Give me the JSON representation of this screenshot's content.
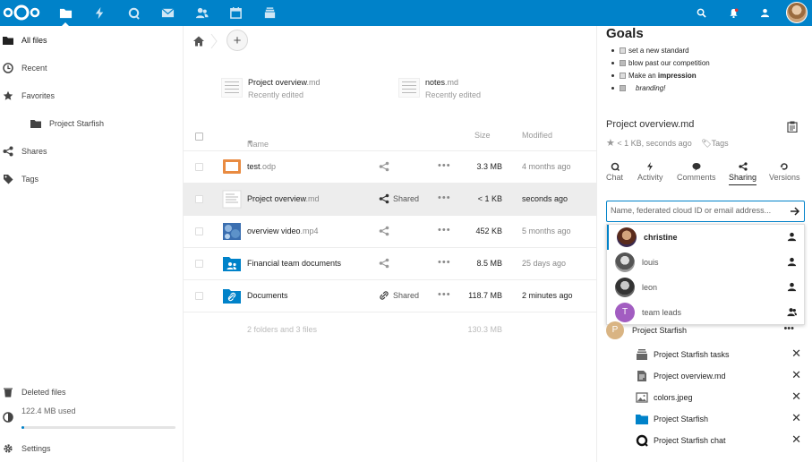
{
  "header": {
    "apps": [
      "files-icon",
      "activity-icon",
      "talk-icon",
      "mail-icon",
      "contacts-icon",
      "calendar-icon",
      "deck-icon"
    ],
    "right": [
      "search-icon",
      "notifications-icon",
      "contacts-menu-icon",
      "user-avatar"
    ],
    "brand_color": "#0082c9"
  },
  "nav": {
    "items": [
      {
        "label": "All files",
        "icon": "folder-icon"
      },
      {
        "label": "Recent",
        "icon": "clock-icon"
      },
      {
        "label": "Favorites",
        "icon": "star-icon"
      },
      {
        "label": "Project Starfish",
        "icon": "folder-icon"
      },
      {
        "label": "Shares",
        "icon": "share-icon"
      },
      {
        "label": "Tags",
        "icon": "tag-icon"
      }
    ],
    "deleted": "Deleted files",
    "quota": "122.4 MB used",
    "quota_fraction": 0.01,
    "settings": "Settings"
  },
  "main": {
    "recent": [
      {
        "name": "Project overview",
        "ext": ".md",
        "sub": "Recently edited"
      },
      {
        "name": "notes",
        "ext": ".md",
        "sub": "Recently edited"
      }
    ],
    "columns": {
      "name": "Name",
      "size": "Size",
      "modified": "Modified"
    },
    "files": [
      {
        "name": "test",
        "ext": ".odp",
        "icon": "presentation-icon",
        "shared": "",
        "size": "3.3 MB",
        "modified": "4 months ago"
      },
      {
        "name": "Project overview",
        "ext": ".md",
        "icon": "document-icon",
        "shared": "Shared",
        "size": "< 1 KB",
        "modified": "seconds ago"
      },
      {
        "name": "overview video",
        "ext": ".mp4",
        "icon": "video-icon",
        "shared": "",
        "size": "452 KB",
        "modified": "5 months ago"
      },
      {
        "name": "Financial team documents",
        "ext": "",
        "icon": "group-folder-icon",
        "shared": "",
        "size": "8.5 MB",
        "modified": "25 days ago"
      },
      {
        "name": "Documents",
        "ext": "",
        "icon": "link-folder-icon",
        "shared": "Shared",
        "size": "118.7 MB",
        "modified": "2 minutes ago"
      }
    ],
    "summary": "2 folders and 3 files",
    "summary_size": "130.3 MB"
  },
  "sidebar": {
    "goals_title": "Goals",
    "goals": [
      {
        "text": "set a new standard",
        "checked": true
      },
      {
        "text": "blow past our competition",
        "checked": false
      },
      {
        "pre": "Make an ",
        "bold": "impression",
        "checked": true
      },
      {
        "italic": "branding!",
        "checked": false
      }
    ],
    "file_name": "Project overview.md",
    "meta": "< 1 KB, seconds ago",
    "tags_label": "Tags",
    "tabs": [
      "Chat",
      "Activity",
      "Comments",
      "Sharing",
      "Versions"
    ],
    "active_tab": "Sharing",
    "share_placeholder": "Name, federated cloud ID or email address...",
    "suggestions": [
      {
        "name": "christine",
        "type": "user"
      },
      {
        "name": "louis",
        "type": "user"
      },
      {
        "name": "leon",
        "type": "user"
      },
      {
        "name": "team leads",
        "type": "group",
        "initial": "T"
      }
    ],
    "project": {
      "initial": "P",
      "name": "Project Starfish",
      "more": "..."
    },
    "resources": [
      {
        "name": "Project Starfish tasks",
        "icon": "deck-icon"
      },
      {
        "name": "Project overview.md",
        "icon": "document-icon"
      },
      {
        "name": "colors.jpeg",
        "icon": "image-icon"
      },
      {
        "name": "Project Starfish",
        "icon": "folder-icon"
      },
      {
        "name": "Project Starfish chat",
        "icon": "talk-icon"
      }
    ]
  }
}
